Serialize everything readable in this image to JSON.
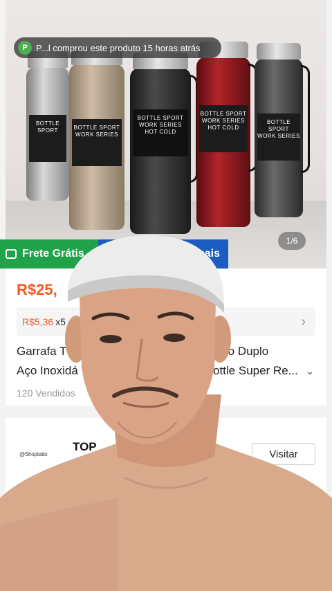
{
  "notification": {
    "avatar_letter": "P",
    "text": "P...l comprou este produto 15 horas atrás"
  },
  "gallery": {
    "counter": "1/6",
    "bottle_label_brand": "BOTTLE SPORT",
    "bottle_label_sub": "WORK SERIES",
    "bottle_label_hot": "HOT",
    "bottle_label_cold": "COLD"
  },
  "badges": {
    "frete": "Frete Grátis",
    "local": "...dutos Locais"
  },
  "product": {
    "price": "R$25,",
    "installment_price": "R$5,36",
    "installment_count": "x5",
    "title_left_1": "Garrafa Té",
    "title_left_2": "Aço Inoxidá",
    "title_right_1": "ento Duplo",
    "title_right_2": "ottle Super Re...",
    "sold": "120 Vendidos"
  },
  "shop": {
    "logo_text": "@Shoptatto",
    "top_label": "TOP",
    "visit_label": "Visitar"
  },
  "colors": {
    "accent": "#f25a22",
    "frete_green": "#1fa24a",
    "local_blue": "#1c5cc0"
  }
}
